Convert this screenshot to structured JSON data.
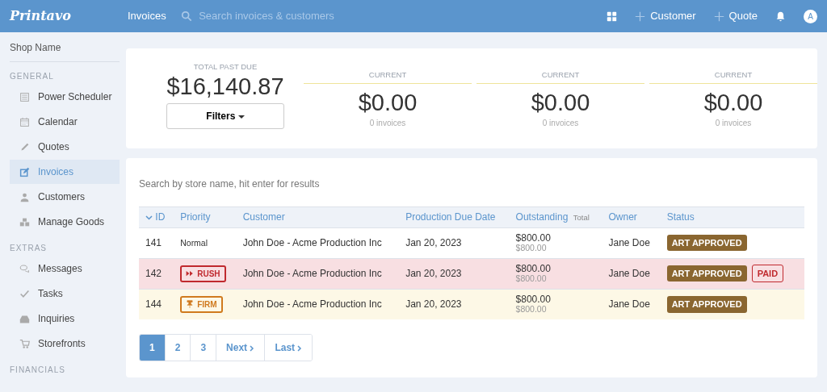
{
  "topbar": {
    "logo": "Printavo",
    "nav": "Invoices",
    "search": {
      "placeholder": "Search invoices & customers"
    },
    "actions": [
      "Customer",
      "Quote"
    ],
    "avatar": "A"
  },
  "sidebar": {
    "shop": "Shop Name",
    "sections": [
      {
        "title": "GENERAL",
        "items": [
          {
            "label": "Power Scheduler",
            "selected": false
          },
          {
            "label": "Calendar",
            "selected": false
          },
          {
            "label": "Quotes",
            "selected": false
          },
          {
            "label": "Invoices",
            "selected": true
          },
          {
            "label": "Customers",
            "selected": false
          },
          {
            "label": "Manage Goods",
            "selected": false
          }
        ]
      },
      {
        "title": "EXTRAS",
        "items": [
          {
            "label": "Messages",
            "selected": false
          },
          {
            "label": "Tasks",
            "selected": false
          },
          {
            "label": "Inquiries",
            "selected": false
          },
          {
            "label": "Storefronts",
            "selected": false
          }
        ]
      },
      {
        "title": "FINANCIALS"
      }
    ]
  },
  "summary": {
    "total": {
      "label": "TOTAL PAST DUE",
      "amount": "$16,140.87"
    },
    "filters": "Filters",
    "buckets": [
      {
        "label": "CURRENT",
        "amount": "$0.00",
        "count": "0 invoices"
      },
      {
        "label": "CURRENT",
        "amount": "$0.00",
        "count": "0 invoices"
      },
      {
        "label": "CURRENT",
        "amount": "$0.00",
        "count": "0 invoices"
      }
    ]
  },
  "table": {
    "search": {
      "placeholder": "Search by store name, hit enter for results"
    },
    "columns": [
      {
        "label": "ID",
        "sorted": true
      },
      {
        "label": "Priority",
        "sorted": false
      },
      {
        "label": "Customer",
        "sorted": false
      },
      {
        "label": "Production Due Date",
        "sorted": false
      },
      {
        "label": "Outstanding",
        "note": "Total",
        "sorted": false
      },
      {
        "label": "Owner",
        "sorted": false
      },
      {
        "label": "Status",
        "sorted": false
      }
    ],
    "rows": [
      {
        "id": "141",
        "priority": {
          "kind": "normal",
          "label": "Normal"
        },
        "customer": "John Doe - Acme Production Inc",
        "due": "Jan 20, 2023",
        "outstanding": "$800.00",
        "total": "$800.00",
        "owner": "Jane Doe",
        "statuses": [
          {
            "kind": "approved",
            "label": "ART APPROVED"
          }
        ]
      },
      {
        "id": "142",
        "priority": {
          "kind": "rush",
          "label": "RUSH"
        },
        "customer": "John Doe - Acme Production Inc",
        "due": "Jan 20, 2023",
        "outstanding": "$800.00",
        "total": "$800.00",
        "owner": "Jane Doe",
        "statuses": [
          {
            "kind": "approved",
            "label": "ART APPROVED"
          },
          {
            "kind": "paid",
            "label": "PAID"
          }
        ]
      },
      {
        "id": "144",
        "priority": {
          "kind": "firm",
          "label": "FIRM"
        },
        "customer": "John Doe - Acme Production Inc",
        "due": "Jan 20, 2023",
        "outstanding": "$800.00",
        "total": "$800.00",
        "owner": "Jane Doe",
        "statuses": [
          {
            "kind": "approved",
            "label": "ART APPROVED"
          }
        ]
      }
    ]
  },
  "pagination": {
    "pages": [
      {
        "label": "1",
        "selected": true
      },
      {
        "label": "2",
        "selected": false
      },
      {
        "label": "3",
        "selected": false
      }
    ],
    "next": "Next",
    "last": "Last"
  }
}
